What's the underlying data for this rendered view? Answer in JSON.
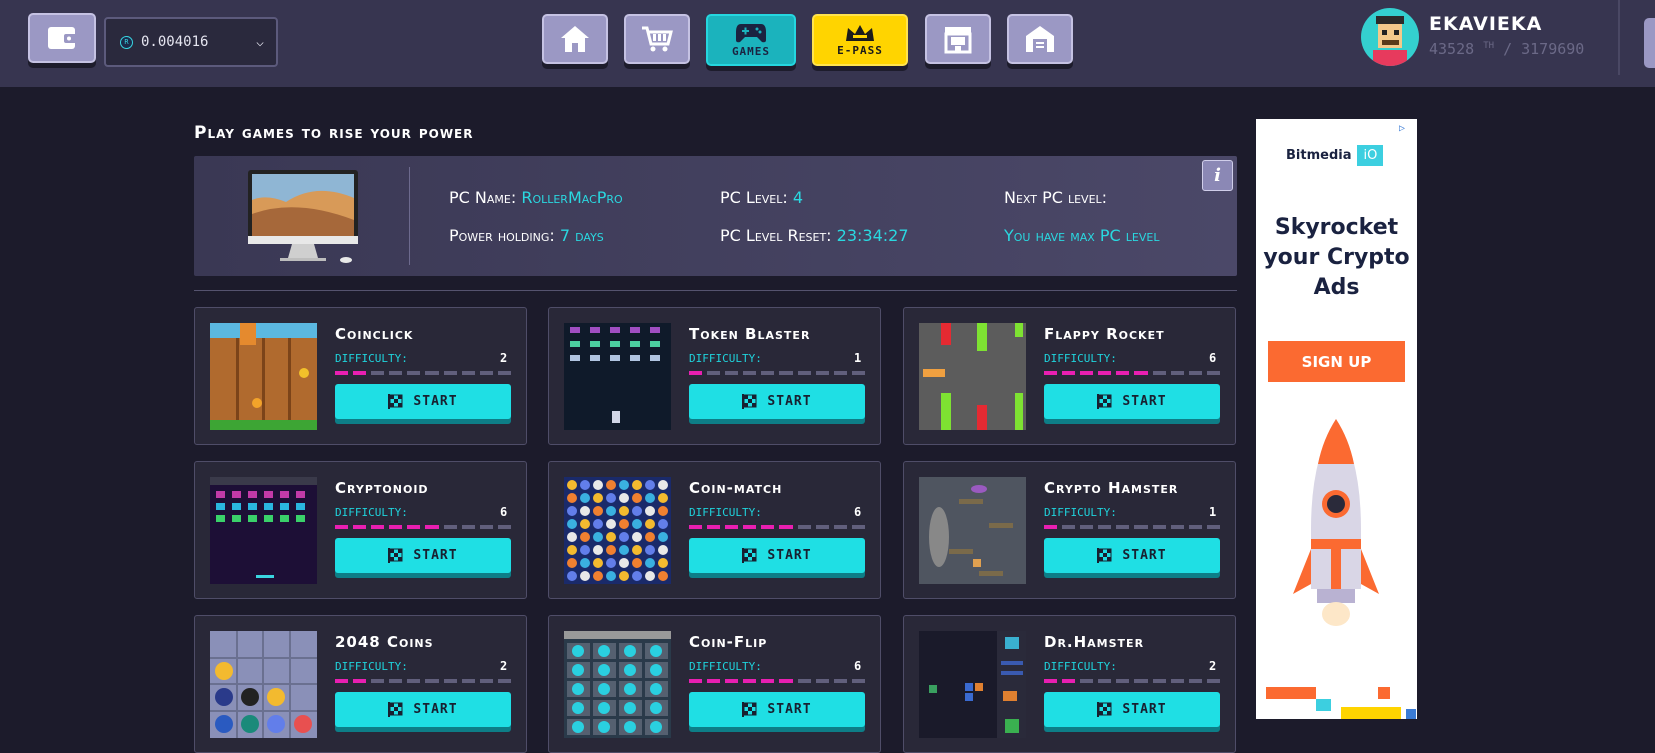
{
  "header": {
    "balance": "0.004016",
    "nav": [
      {
        "id": "home",
        "label": ""
      },
      {
        "id": "market",
        "label": ""
      },
      {
        "id": "games",
        "label": "GAMES"
      },
      {
        "id": "epass",
        "label": "E-PASS"
      },
      {
        "id": "store",
        "label": ""
      },
      {
        "id": "rooms",
        "label": ""
      }
    ],
    "user": {
      "name": "EKAVIEKA",
      "power": "43528",
      "unit": "TH",
      "rank_separator": "/",
      "total": "3179690"
    }
  },
  "main": {
    "title": "Play games to rise your power",
    "pc": {
      "name_label": "PC Name:",
      "name": "RollerMacPro",
      "level_label": "PC Level:",
      "level": "4",
      "next_label": "Next PC level:",
      "power_label": "Power holding:",
      "power": "7 days",
      "reset_label": "PC Level Reset:",
      "reset": "23:34:27",
      "next_value": "You have max PC level",
      "info": "i"
    },
    "difficulty_label": "DIFFICULTY:",
    "start_label": "START",
    "games": [
      {
        "name": "Coinclick",
        "difficulty": 2
      },
      {
        "name": "Token Blaster",
        "difficulty": 1
      },
      {
        "name": "Flappy Rocket",
        "difficulty": 6
      },
      {
        "name": "Cryptonoid",
        "difficulty": 6
      },
      {
        "name": "Coin-match",
        "difficulty": 6
      },
      {
        "name": "Crypto Hamster",
        "difficulty": 1
      },
      {
        "name": "2048 Coins",
        "difficulty": 2
      },
      {
        "name": "Coin-Flip",
        "difficulty": 6
      },
      {
        "name": "Dr.Hamster",
        "difficulty": 2
      }
    ]
  },
  "ad": {
    "brand": "Bitmedia",
    "brand_suffix": "iO",
    "headline": "Skyrocket your Crypto Ads",
    "cta": "SIGN UP",
    "colors": {
      "accent": "#fb6a31",
      "brand": "#3ccfe0"
    }
  },
  "colors": {
    "cyan": "#1fdfe4",
    "magenta": "#e81fb1",
    "yellow": "#ffd400"
  }
}
